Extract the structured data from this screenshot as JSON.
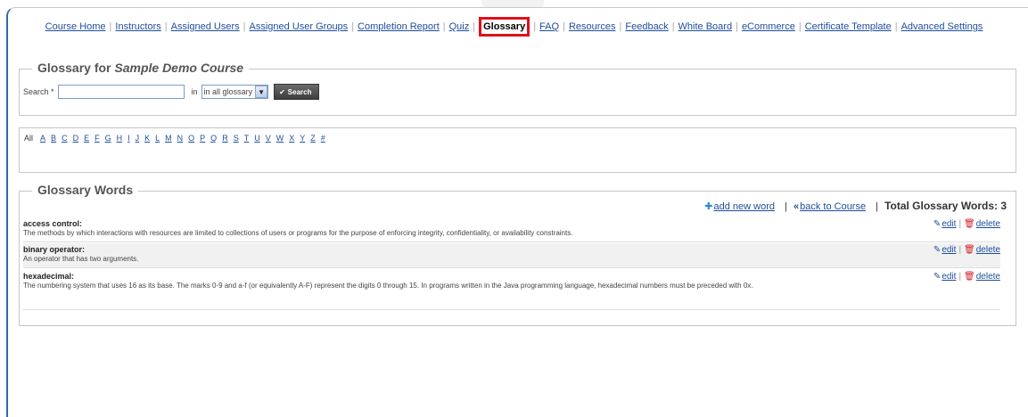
{
  "nav": {
    "items": [
      "Course Home",
      "Instructors",
      "Assigned Users",
      "Assigned User Groups",
      "Completion Report",
      "Quiz",
      "Glossary",
      "FAQ",
      "Resources",
      "Feedback",
      "White Board",
      "eCommerce",
      "Certificate Template",
      "Advanced Settings"
    ],
    "active_index": 6
  },
  "search_panel": {
    "title_prefix": "Glossary for ",
    "course_name": "Sample Demo Course",
    "search_label": "Search *",
    "search_value": "",
    "in_label": "in",
    "scope_selected": "in all glossary",
    "search_button": "Search"
  },
  "alphabet": {
    "all_label": "All",
    "letters": [
      "A",
      "B",
      "C",
      "D",
      "E",
      "F",
      "G",
      "H",
      "I",
      "J",
      "K",
      "L",
      "M",
      "N",
      "O",
      "P",
      "Q",
      "R",
      "S",
      "T",
      "U",
      "V",
      "W",
      "X",
      "Y",
      "Z",
      "#"
    ]
  },
  "words_panel": {
    "title": "Glossary Words",
    "add_new_label": "add new word",
    "back_label": "back to Course",
    "total_label": "Total Glossary Words: 3",
    "entries": [
      {
        "term": "access control:",
        "definition": "The methods by which interactions with resources are limited to collections of users or programs for the purpose of enforcing integrity, confidentiality, or availability constraints."
      },
      {
        "term": "binary operator:",
        "definition": "An operator that has two arguments."
      },
      {
        "term": "hexadecimal:",
        "definition": "The numbering system that uses 16 as its base. The marks 0-9 and a-f (or equivalently A-F) represent the digits 0 through 15. In programs written in the Java programming language, hexadecimal numbers must be preceded with 0x."
      }
    ],
    "edit_label": "edit",
    "delete_label": "delete"
  },
  "colors": {
    "link": "#1f4e9c",
    "active_highlight": "#e0101a",
    "frame_accent": "#2e6da4"
  },
  "icons": {
    "add": "plus-icon",
    "back": "double-chevron-left-icon",
    "edit": "pencil-icon",
    "delete": "trash-icon",
    "search": "checkmark-icon",
    "dropdown": "chevron-down-icon"
  }
}
